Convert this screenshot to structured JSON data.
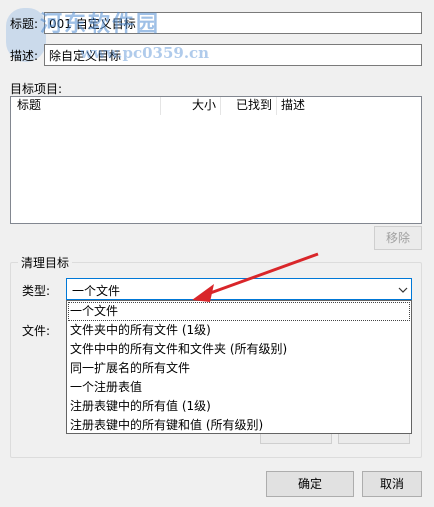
{
  "form": {
    "title_label": "标题:",
    "title_value": "001 自定义目标",
    "desc_label": "描述:",
    "desc_value": "除自定义目标"
  },
  "targets": {
    "section_label": "目标项目:",
    "columns": [
      "标题",
      "大小",
      "已找到",
      "描述"
    ],
    "remove_button": "移除"
  },
  "cleanup": {
    "group_title": "清理目标",
    "type_label": "类型:",
    "type_value": "一个文件",
    "file_label": "文件:",
    "options": [
      "一个文件",
      "文件夹中的所有文件 (1级)",
      "文件中中的所有文件和文件夹 (所有级别)",
      "同一扩展名的所有文件",
      "一个注册表值",
      "注册表键中的所有值 (1级)",
      "注册表键中的所有键和值 (所有级别)"
    ]
  },
  "footer": {
    "ok_button": "确定",
    "cancel_button": "取消"
  },
  "watermark": {
    "site_name": "河东软件园",
    "url": "www.pc0359.cn"
  },
  "colors": {
    "arrow": "#d9262a",
    "focus_border": "#0078d7",
    "watermark": "#508cd2"
  }
}
